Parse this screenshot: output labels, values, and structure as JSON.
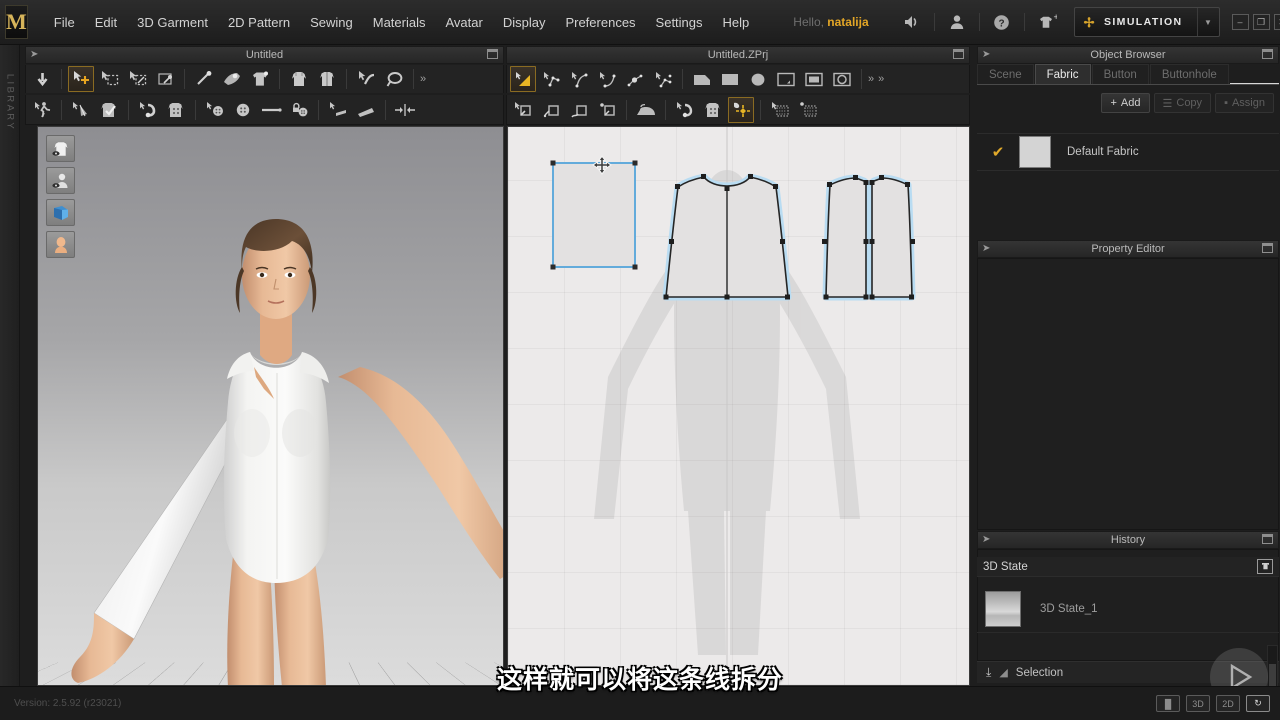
{
  "app": {
    "logo_letter": "M",
    "version_text": "Version: 2.5.92    (r23021)"
  },
  "menu": {
    "items": [
      {
        "label": "File"
      },
      {
        "label": "Edit"
      },
      {
        "label": "3D Garment"
      },
      {
        "label": "2D Pattern"
      },
      {
        "label": "Sewing"
      },
      {
        "label": "Materials"
      },
      {
        "label": "Avatar"
      },
      {
        "label": "Display"
      },
      {
        "label": "Preferences"
      },
      {
        "label": "Settings"
      },
      {
        "label": "Help"
      }
    ],
    "greeting_prefix": "Hello, ",
    "user_name": "natalija",
    "icons": [
      {
        "name": "volume-icon",
        "glyph": "◂))"
      },
      {
        "name": "user-account-icon",
        "glyph": "●"
      },
      {
        "name": "help-icon",
        "glyph": "?"
      },
      {
        "name": "add-garment-icon",
        "glyph": "+"
      }
    ],
    "simulation_label": "SIMULATION",
    "window_buttons": [
      {
        "name": "minimize-button",
        "glyph": "–"
      },
      {
        "name": "restore-button",
        "glyph": "❐"
      },
      {
        "name": "close-button",
        "glyph": "✕"
      }
    ]
  },
  "library": {
    "rail_label": "LIBRARY"
  },
  "panels": {
    "garment_3d": {
      "title": "Untitled"
    },
    "pattern_2d": {
      "title": "Untitled.ZPrj"
    },
    "object_browser": {
      "title": "Object Browser",
      "tabs": [
        {
          "label": "Scene",
          "selected": false
        },
        {
          "label": "Fabric",
          "selected": true
        },
        {
          "label": "Button",
          "selected": false
        },
        {
          "label": "Buttonhole",
          "selected": false
        }
      ],
      "actions": [
        {
          "label": "Add",
          "enabled": true
        },
        {
          "label": "Copy",
          "enabled": false
        },
        {
          "label": "Assign",
          "enabled": false
        }
      ],
      "items": [
        {
          "name": "Default Fabric",
          "checked": true,
          "swatch_color": "#d4d4d4"
        }
      ]
    },
    "property_editor": {
      "title": "Property Editor",
      "content": ""
    },
    "history": {
      "title": "History",
      "section_label": "3D State",
      "items": [
        {
          "label": "3D State_1"
        }
      ],
      "selection_label": "Selection"
    }
  },
  "viewport_3d": {
    "tools": [
      {
        "name": "show-garment-toggle",
        "glyph": "garment"
      },
      {
        "name": "show-avatar-toggle",
        "glyph": "avatar"
      },
      {
        "name": "show-texture-toggle",
        "glyph": "book"
      },
      {
        "name": "show-skin-toggle",
        "glyph": "skin"
      }
    ]
  },
  "viewport_2d": {
    "cursor": "move-cursor",
    "pieces": [
      {
        "name": "rectangle-pattern",
        "selected": true
      },
      {
        "name": "front-bodice-pattern",
        "selected": false
      },
      {
        "name": "back-bodice-pattern-left",
        "selected": false
      },
      {
        "name": "back-bodice-pattern-right",
        "selected": false
      }
    ]
  },
  "bottom": {
    "view_buttons": [
      {
        "name": "split-view-button",
        "label": "▐▌"
      },
      {
        "name": "view-3d-button",
        "label": "3D"
      },
      {
        "name": "view-2d-button",
        "label": "2D"
      },
      {
        "name": "sync-button",
        "label": "↻"
      }
    ]
  },
  "toolbar_3d": {
    "row1": [
      "arrow-down-tool",
      "transform-add-tool",
      "rect-select-tool",
      "free-select-tool",
      "pin-drag-tool",
      "pin-tool",
      "tack-tool",
      "garment-fold-tool",
      "flatten-tool",
      "symmetric-tool",
      "curve-tool",
      "lasso-tool"
    ],
    "row2": [
      "avatar-walk-tool",
      "fold-arrange-tool",
      "garment-check-tool",
      "zipper-tool",
      "button-garment-tool",
      "button-tool",
      "button-head-tool",
      "line-tool",
      "lock-button-tool",
      "plane-tool",
      "box-tool",
      "align-tool"
    ],
    "overflow_label": "»"
  },
  "toolbar_2d": {
    "row1": [
      "polygon-tool",
      "edit-point-tool",
      "curve-point-tool",
      "curve-edit-tool",
      "round-point-tool",
      "segment-tool",
      "polygon-shape-tool",
      "rectangle-shape-tool",
      "circle-shape-tool",
      "inner-polygon-tool",
      "inner-rectangle-tool",
      "inner-circle-tool"
    ],
    "row2": [
      "sew-tool",
      "segment-sew-tool",
      "free-sew-tool",
      "copy-sew-tool",
      "iron-tool",
      "zipper-2d-tool",
      "button-2d-tool",
      "trace-tool",
      "pattern-layout-tool",
      "pattern-arrange-tool"
    ],
    "overflow_label": "»"
  },
  "subtitle": {
    "text": "这样就可以将这条线拆分"
  },
  "colors": {
    "accent_gold": "#e3a626",
    "panel_bg": "#1f1f1f",
    "menubar_bg": "#2a2a2a",
    "selection_blue": "#5ba8d8",
    "pattern_fill": "#e3e1e1",
    "viewport2d_bg": "#eceaea"
  }
}
